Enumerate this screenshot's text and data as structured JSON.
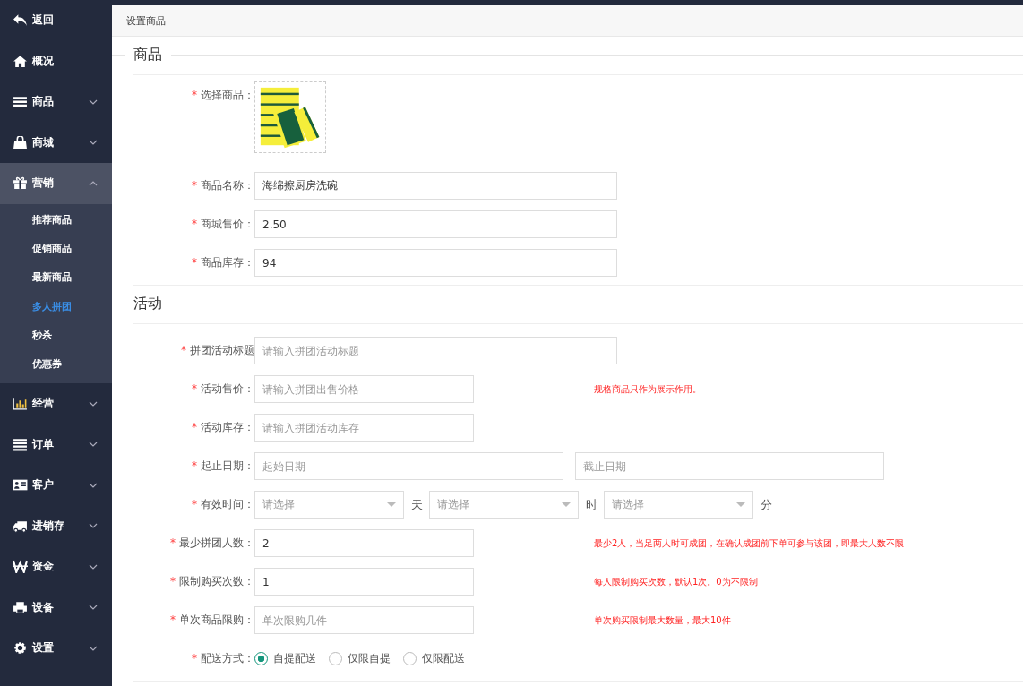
{
  "sidebar": {
    "items": [
      {
        "label": "返回",
        "kind": "link",
        "expanded": false
      },
      {
        "label": "概况",
        "kind": "link",
        "expanded": false
      },
      {
        "label": "商品",
        "kind": "menu",
        "expanded": false
      },
      {
        "label": "商城",
        "kind": "menu",
        "expanded": false
      },
      {
        "label": "营销",
        "kind": "menu",
        "expanded": true,
        "children": [
          {
            "label": "推荐商品",
            "selected": false
          },
          {
            "label": "促销商品",
            "selected": false
          },
          {
            "label": "最新商品",
            "selected": false
          },
          {
            "label": "多人拼团",
            "selected": true
          },
          {
            "label": "秒杀",
            "selected": false
          },
          {
            "label": "优惠券",
            "selected": false
          }
        ]
      },
      {
        "label": "经营",
        "kind": "menu",
        "expanded": false
      },
      {
        "label": "订单",
        "kind": "menu",
        "expanded": false
      },
      {
        "label": "客户",
        "kind": "menu",
        "expanded": false
      },
      {
        "label": "进销存",
        "kind": "menu",
        "expanded": false
      },
      {
        "label": "资金",
        "kind": "menu",
        "expanded": false
      },
      {
        "label": "设备",
        "kind": "menu",
        "expanded": false
      },
      {
        "label": "设置",
        "kind": "menu",
        "expanded": false
      }
    ]
  },
  "page_title": "设置商品",
  "sections": [
    {
      "title": "商品",
      "fields": [
        {
          "kind": "image",
          "mark": "*",
          "label": "选择商品："
        },
        {
          "kind": "input",
          "mark": "*",
          "label": "商品名称：",
          "value": "海绵擦厨房洗碗"
        },
        {
          "kind": "input",
          "mark": "*",
          "label": "商城售价：",
          "value": "2.50"
        },
        {
          "kind": "input",
          "mark": "*",
          "label": "商品库存：",
          "value": "94"
        }
      ]
    },
    {
      "title": "活动",
      "fields": [
        {
          "kind": "input",
          "mark": "*",
          "label": "拼团活动标题",
          "placeholder": "请输入拼团活动标题"
        },
        {
          "kind": "short-input",
          "mark": "*",
          "label": "活动售价：",
          "placeholder": "请输入拼团出售价格",
          "hint": "规格商品只作为展示作用。"
        },
        {
          "kind": "short-input",
          "mark": "*",
          "label": "活动库存：",
          "placeholder": "请输入拼团活动库存"
        },
        {
          "kind": "range",
          "mark": "*",
          "label": "起止日期：",
          "start_placeholder": "起始日期",
          "separator": "-",
          "end_placeholder": "截止日期"
        },
        {
          "kind": "duration",
          "mark": "*",
          "label": "有效时间：",
          "parts": [
            {
              "placeholder": "请选择",
              "unit": "天"
            },
            {
              "placeholder": "请选择",
              "unit": "时"
            },
            {
              "placeholder": "请选择",
              "unit": "分"
            }
          ]
        },
        {
          "kind": "short-input",
          "mark": "*",
          "label": "最少拼团人数：",
          "value": "2",
          "hint": "最少2人，当足两人时可成团，在确认成团前下单可参与该团，即最大人数不限"
        },
        {
          "kind": "short-input",
          "mark": "*",
          "label": "限制购买次数：",
          "value": "1",
          "hint": "每人限制购买次数，默认1次。0为不限制"
        },
        {
          "kind": "short-input",
          "mark": "*",
          "label": "单次商品限购：",
          "placeholder": "单次限购几件",
          "hint": "单次购买限制最大数量，最大10件"
        },
        {
          "kind": "radio",
          "mark": "*",
          "label": "配送方式：",
          "options": [
            {
              "label": "自提配送",
              "selected": true
            },
            {
              "label": "仅限自提",
              "selected": false
            },
            {
              "label": "仅限配送",
              "selected": false
            }
          ]
        }
      ]
    }
  ]
}
